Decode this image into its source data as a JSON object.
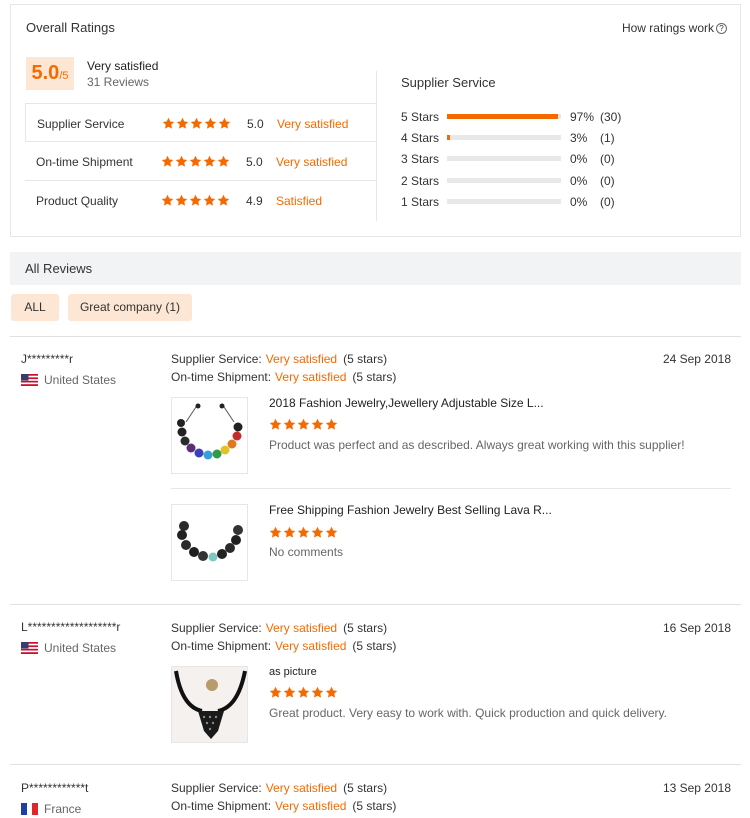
{
  "overall": {
    "title": "Overall Ratings",
    "how_link": "How ratings work",
    "score": "5.0",
    "score_max": "/5",
    "summary": "Very satisfied",
    "reviews": "31 Reviews",
    "rows": [
      {
        "label": "Supplier Service",
        "stars": 5,
        "value": "5.0",
        "word": "Very satisfied"
      },
      {
        "label": "On-time Shipment",
        "stars": 5,
        "value": "5.0",
        "word": "Very satisfied"
      },
      {
        "label": "Product Quality",
        "stars": 5,
        "value": "4.9",
        "word": "Satisfied"
      }
    ],
    "breakdown_title": "Supplier Service",
    "breakdown": [
      {
        "label": "5 Stars",
        "fraction": 0.97,
        "pct": "97%",
        "count": "(30)"
      },
      {
        "label": "4 Stars",
        "fraction": 0.03,
        "pct": "3%",
        "count": "(1)"
      },
      {
        "label": "3 Stars",
        "fraction": 0,
        "pct": "0%",
        "count": "(0)"
      },
      {
        "label": "2 Stars",
        "fraction": 0,
        "pct": "0%",
        "count": "(0)"
      },
      {
        "label": "1 Stars",
        "fraction": 0,
        "pct": "0%",
        "count": "(0)"
      }
    ]
  },
  "all_reviews": {
    "title": "All Reviews",
    "filter_all": "ALL",
    "filter_tag": "Great company (1)"
  },
  "colors": {
    "accent": "#f56a00",
    "accent_light": "#fde6d4"
  },
  "reviews": [
    {
      "name": "J*********r",
      "country": "United States",
      "flag": "us-flag",
      "date": "24 Sep 2018",
      "service_label": "Supplier Service:",
      "service_value": "Very satisfied",
      "service_stars": "(5 stars)",
      "shipment_label": "On-time Shipment:",
      "shipment_value": "Very satisfied",
      "shipment_stars": "(5 stars)",
      "items": [
        {
          "title": "2018 Fashion Jewelry,Jewellery Adjustable Size L...",
          "stars": 5,
          "comment": "Product was perfect and as described. Always great working with this supplier!",
          "image": "chakra-bracelet-image"
        },
        {
          "title": "Free Shipping Fashion Jewelry Best Selling Lava R...",
          "stars": 5,
          "comment": "No comments",
          "image": "lava-bracelet-image"
        }
      ]
    },
    {
      "name": "L*******************r",
      "country": "United States",
      "flag": "us-flag",
      "date": "16 Sep 2018",
      "service_label": "Supplier Service:",
      "service_value": "Very satisfied",
      "service_stars": "(5 stars)",
      "shipment_label": "On-time Shipment:",
      "shipment_value": "Very satisfied",
      "shipment_stars": "(5 stars)",
      "items": [
        {
          "title": "as picture",
          "stars": 5,
          "comment": "Great product. Very easy to work with. Quick production and quick delivery.",
          "image": "necklace-image"
        }
      ]
    },
    {
      "name": "P************t",
      "country": "France",
      "flag": "fr-flag",
      "date": "13 Sep 2018",
      "service_label": "Supplier Service:",
      "service_value": "Very satisfied",
      "service_stars": "(5 stars)",
      "shipment_label": "On-time Shipment:",
      "shipment_value": "Very satisfied",
      "shipment_stars": "(5 stars)",
      "items": []
    }
  ]
}
